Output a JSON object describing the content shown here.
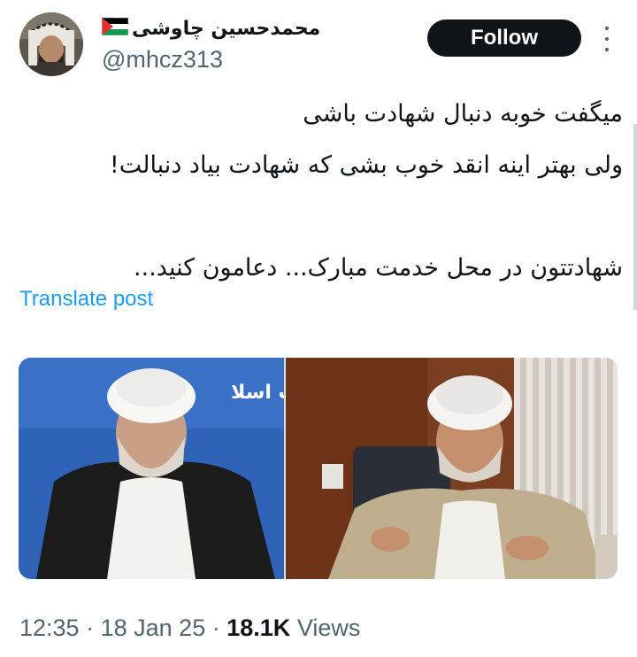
{
  "author": {
    "display_name": "محمدحسین چاوشی",
    "flag_icon": "palestine-flag-icon",
    "handle": "@mhcz313"
  },
  "actions": {
    "follow_label": "Follow",
    "more_icon": "more-options-icon"
  },
  "post": {
    "lines": [
      "میگفت خوبه دنبال شهادت باشی",
      "ولی بهتر اینه انقد خوب بشی که شهادت بیاد دنبالت!",
      "",
      "شهادتتون در محل خدمت مبارک... دعامون کنید..."
    ],
    "translate_label": "Translate post"
  },
  "media": {
    "banner_text": "دادگاه انقلاب اسلا"
  },
  "meta": {
    "time": "12:35",
    "date": "18 Jan 25",
    "views_count": "18.1K",
    "views_label": "Views",
    "separator": "·"
  },
  "colors": {
    "follow_bg": "#0f1419",
    "link": "#1d9bf0",
    "secondary_text": "#536471",
    "banner_blue": "#2f63b8"
  }
}
